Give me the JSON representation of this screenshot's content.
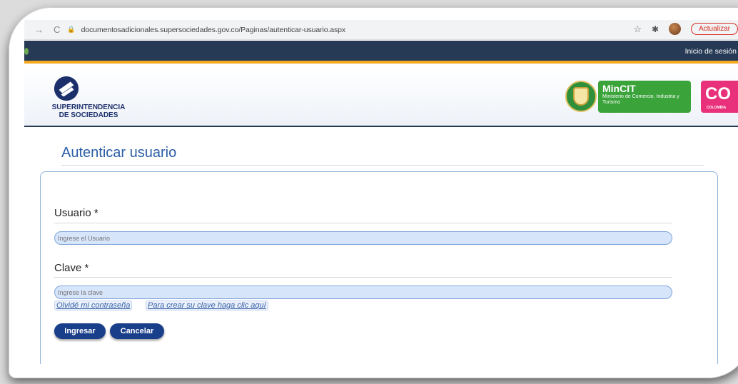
{
  "browser": {
    "back": "←",
    "forward": "→",
    "reload": "C",
    "url": "documentosadicionales.supersociedades.gov.co/Paginas/autenticar-usuario.aspx",
    "update_label": "Actualizar"
  },
  "topnav": {
    "login_link": "Inicio de sesión"
  },
  "header": {
    "org_name_line1": "SUPERINTENDENCIA",
    "org_name_line2": "DE SOCIEDADES",
    "mincit_title": "MinCIT",
    "mincit_sub": "Ministerio de Comercio, Industria y Turismo",
    "co_text": "CO",
    "co_sub": "COLOMBIA"
  },
  "form": {
    "title": "Autenticar usuario",
    "user_label": "Usuario *",
    "user_placeholder": "Ingrese el Usuario",
    "password_label": "Clave *",
    "password_placeholder": "Ingrese la clave",
    "forgot_link": "Olvidé mi contraseña",
    "create_link": "Para crear su clave haga clic aquí",
    "submit_label": "Ingresar",
    "cancel_label": "Cancelar"
  },
  "colors": {
    "nav_bg": "#263955",
    "nav_accent": "#f3a81d",
    "title": "#2a5da6",
    "button": "#1a3f8a",
    "input_bg": "#d7e5fb"
  }
}
